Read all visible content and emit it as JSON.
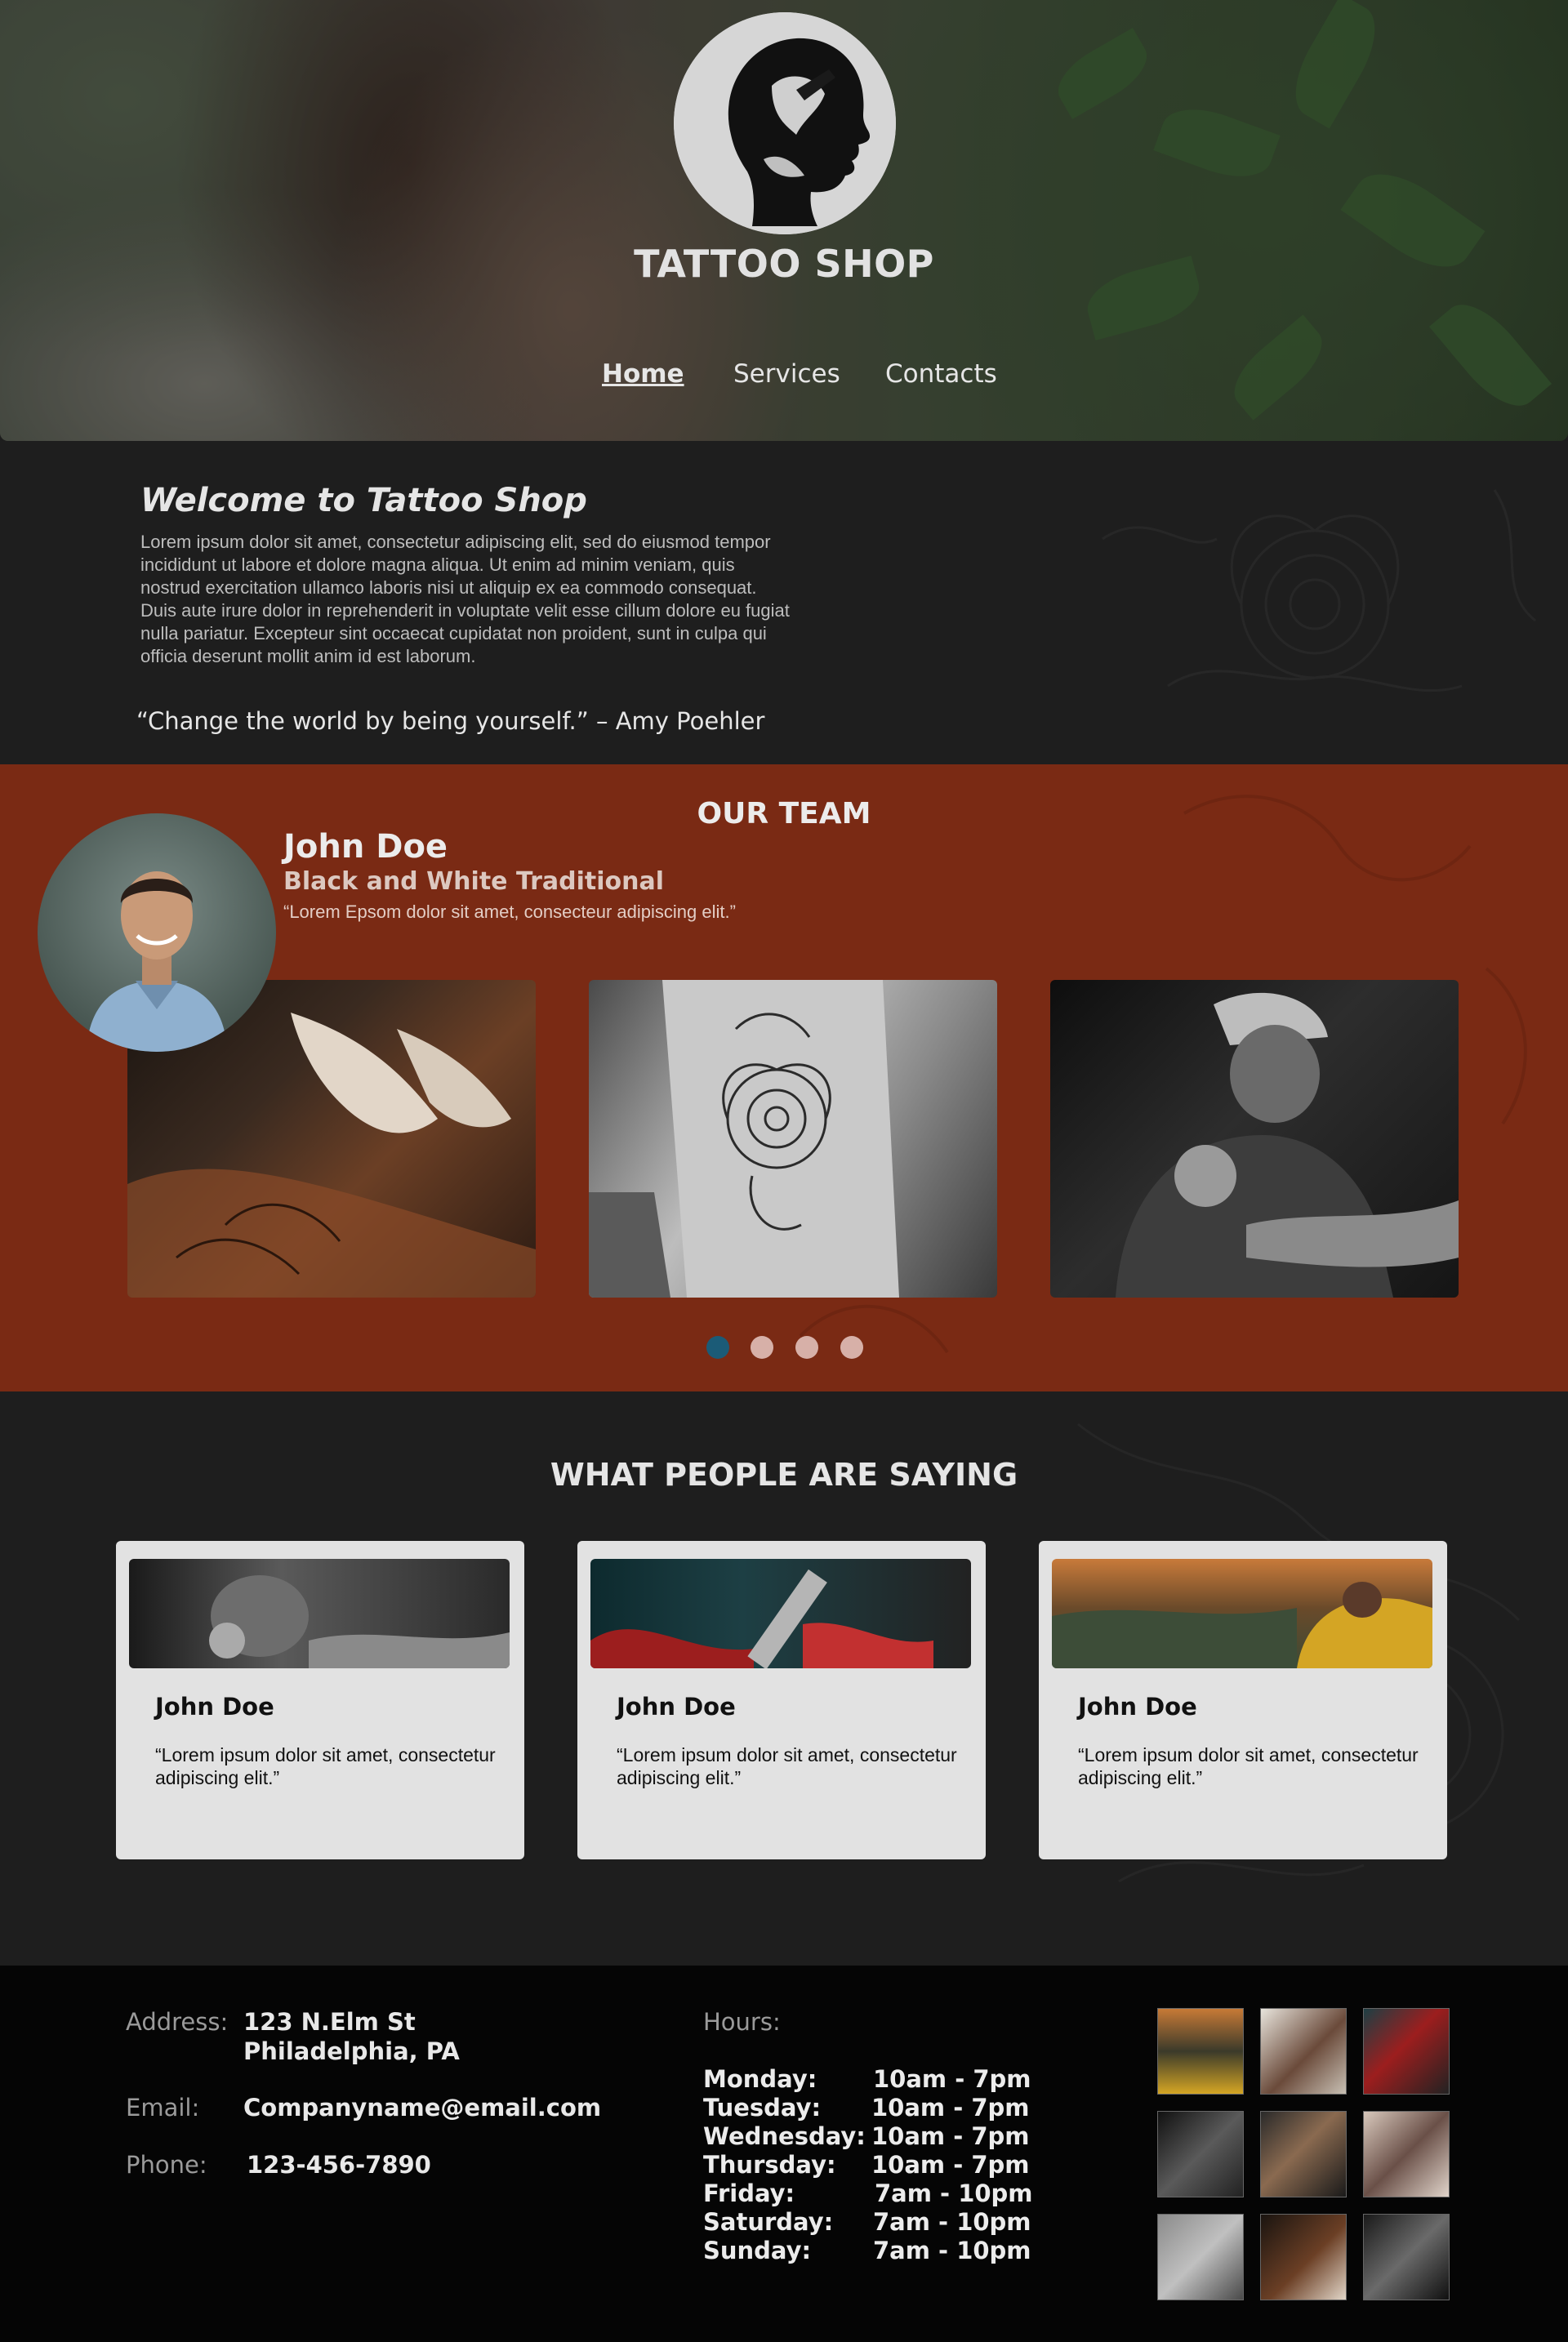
{
  "site": {
    "title": "TATTOO SHOP",
    "nav": [
      "Home",
      "Services",
      "Contacts"
    ],
    "active_nav": "Home"
  },
  "welcome": {
    "heading": "Welcome to Tattoo Shop",
    "body": "Lorem ipsum dolor sit amet, consectetur adipiscing elit, sed do eiusmod tempor incididunt ut labore et dolore magna aliqua. Ut enim ad minim veniam, quis nostrud exercitation ullamco laboris nisi ut aliquip ex ea commodo consequat. Duis aute irure dolor in reprehenderit in voluptate velit esse cillum dolore eu fugiat nulla pariatur. Excepteur sint occaecat cupidatat non proident, sunt in culpa qui officia deserunt mollit anim id est laborum.",
    "quote": "“Change the world by being yourself.” – Amy Poehler"
  },
  "team": {
    "heading": "OUR TEAM",
    "member": {
      "name": "John Doe",
      "style": "Black and White Traditional",
      "quote": "“Lorem Epsom dolor sit amet, consecteur adipiscing elit.”"
    },
    "carousel": {
      "slides": 4,
      "active_index": 0
    }
  },
  "testimonials": {
    "heading": "WHAT PEOPLE ARE SAYING",
    "cards": [
      {
        "name": "John Doe",
        "text": "“Lorem ipsum dolor sit amet, consectetur adipiscing elit.”"
      },
      {
        "name": "John Doe",
        "text": "“Lorem ipsum dolor sit amet, consectetur adipiscing elit.”"
      },
      {
        "name": "John Doe",
        "text": "“Lorem ipsum dolor sit amet, consectetur adipiscing elit.”"
      }
    ]
  },
  "footer": {
    "address_label": "Address:",
    "address_line1": "123 N.Elm St",
    "address_line2": "Philadelphia, PA",
    "email_label": "Email:",
    "email": "Companyname@email.com",
    "phone_label": "Phone:",
    "phone": "123-456-7890",
    "hours_label": "Hours:",
    "hours": [
      {
        "day": "Monday:",
        "time": "10am - 7pm"
      },
      {
        "day": "Tuesday:",
        "time": "10am - 7pm"
      },
      {
        "day": "Wednesday:",
        "time": "10am - 7pm"
      },
      {
        "day": "Thursday:",
        "time": "10am - 7pm"
      },
      {
        "day": "Friday:",
        "time": "7am - 10pm"
      },
      {
        "day": "Saturday:",
        "time": "7am - 10pm"
      },
      {
        "day": "Sunday:",
        "time": "7am - 10pm"
      }
    ]
  },
  "colors": {
    "team_bg": "#7a2a14",
    "dark_bg": "#1e1e1e",
    "footer_bg": "#050505",
    "card_bg": "#e2e2e2",
    "carousel_active": "#1b5b77",
    "carousel_inactive": "#d7b0a8"
  },
  "icons": [
    "tattoo-head-logo-icon"
  ]
}
